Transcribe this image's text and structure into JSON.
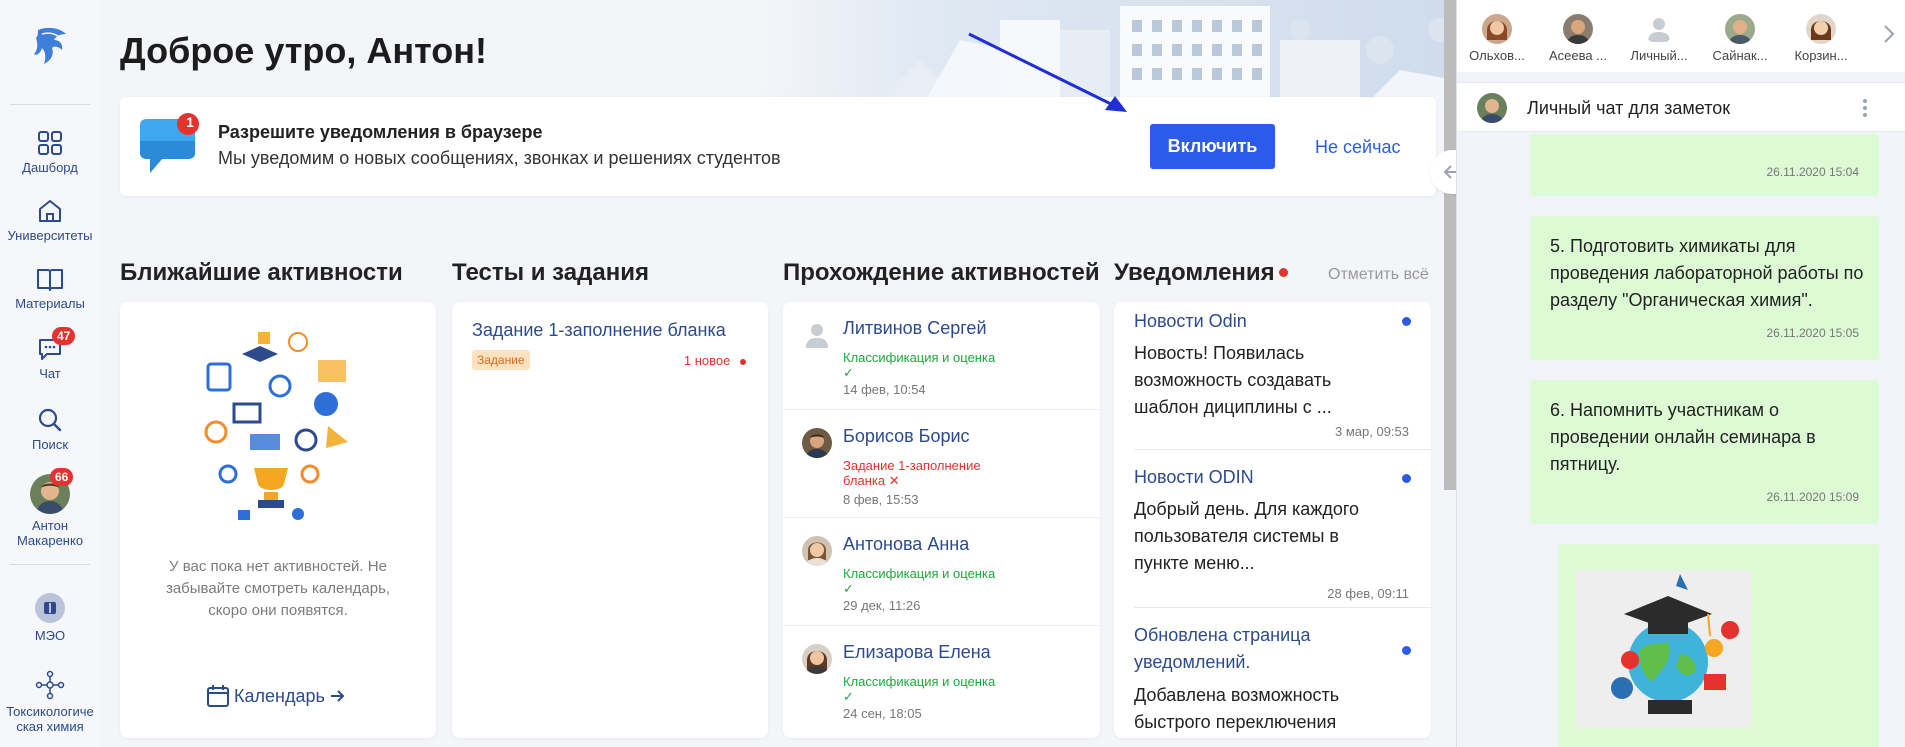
{
  "nav": {
    "dashboard": "Дашборд",
    "universities": "Университеты",
    "materials": "Материалы",
    "chat": "Чат",
    "chat_badge": "47",
    "search": "Поиск",
    "user_name": "Антон Макаренко",
    "user_badge": "66",
    "meo": "МЭО",
    "toxicology": "Токсикологическая химия"
  },
  "greeting": "Доброе утро, Антон!",
  "notify": {
    "badge": "1",
    "title": "Разрешите уведомления в браузере",
    "text": "Мы уведомим о новых сообщениях, звонках и решениях студентов",
    "enable_button": "Включить",
    "later_button": "Не сейчас"
  },
  "columns": {
    "activities_title": "Ближайшие активности",
    "tests_title": "Тесты и задания",
    "progress_title": "Прохождение активностей",
    "notifications_title": "Уведомления",
    "mark_all": "Отметить всё"
  },
  "activities": {
    "empty_text": "У вас пока нет активностей. Не забывайте смотреть календарь, скоро они появятся.",
    "calendar_link": "Календарь"
  },
  "tests": {
    "title": "Задание 1-заполнение бланка",
    "tag": "Задание",
    "new_label": "1 новое"
  },
  "progress": [
    {
      "name": "Литвинов Сергей",
      "status": "Классификация и оценка",
      "ok": true,
      "time": "14 фев, 10:54"
    },
    {
      "name": "Борисов Борис",
      "status": "Задание 1-заполнение бланка",
      "ok": false,
      "time": "8 фев, 15:53"
    },
    {
      "name": "Антонова Анна",
      "status": "Классификация и оценка",
      "ok": true,
      "time": "29 дек, 11:26"
    },
    {
      "name": "Елизарова Елена",
      "status": "Классификация и оценка",
      "ok": true,
      "time": "24 сен, 18:05"
    }
  ],
  "notifications": [
    {
      "title": "Новости Odin",
      "body": "Новость! Появилась возможность создавать шаблон дициплины с ...",
      "time": "3 мар, 09:53"
    },
    {
      "title": "Новости ODIN",
      "body": "Добрый день. Для каждого пользователя системы в пункте меню...",
      "time": "28 фев, 09:11"
    },
    {
      "title": "Обновлена страница уведомлений.",
      "body": "Добавлена возможность быстрого переключения",
      "time": ""
    }
  ],
  "chat": {
    "users": [
      "Ольхов...",
      "Асеева ...",
      "Личный...",
      "Сайнак...",
      "Корзин..."
    ],
    "header_title": "Личный чат для заметок",
    "messages": [
      {
        "text": "",
        "time": "26.11.2020 15:04"
      },
      {
        "text": "5. Подготовить химикаты для проведения лабораторной работы по разделу \"Органическая химия\".",
        "time": "26.11.2020 15:05"
      },
      {
        "text": "6. Напомнить участникам о проведении онлайн семинара в пятницу.",
        "time": "26.11.2020 15:09"
      }
    ]
  },
  "colors": {
    "accent": "#2c5ae9",
    "link": "#2d4a8c",
    "badge": "#e5322d",
    "success": "#1fa83a",
    "chat_bubble": "#dcfbd4"
  }
}
